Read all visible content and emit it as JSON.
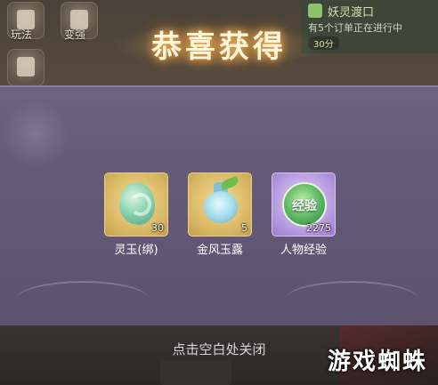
{
  "top_left_menu": [
    {
      "label": "玩法"
    },
    {
      "label": "变强"
    }
  ],
  "notification": {
    "title": "妖灵渡口",
    "text": "有5个订单正在进行中",
    "time": "30分"
  },
  "reward_popup": {
    "title": "恭喜获得",
    "items": [
      {
        "name": "灵玉(绑)",
        "count": "30",
        "icon": "jade-icon"
      },
      {
        "name": "金风玉露",
        "count": "5",
        "icon": "potion-bottle-icon"
      },
      {
        "name": "人物经验",
        "count": "2275",
        "icon": "experience-orb-icon",
        "icon_text": "经验"
      }
    ],
    "close_hint": "点击空白处关闭"
  },
  "watermark": {
    "text": "游戏蜘蛛"
  },
  "colors": {
    "title_glow": "#f0b35b",
    "panel": "#655a78",
    "gold_frame": "#d9b865",
    "purple_frame": "#b69ae0"
  }
}
